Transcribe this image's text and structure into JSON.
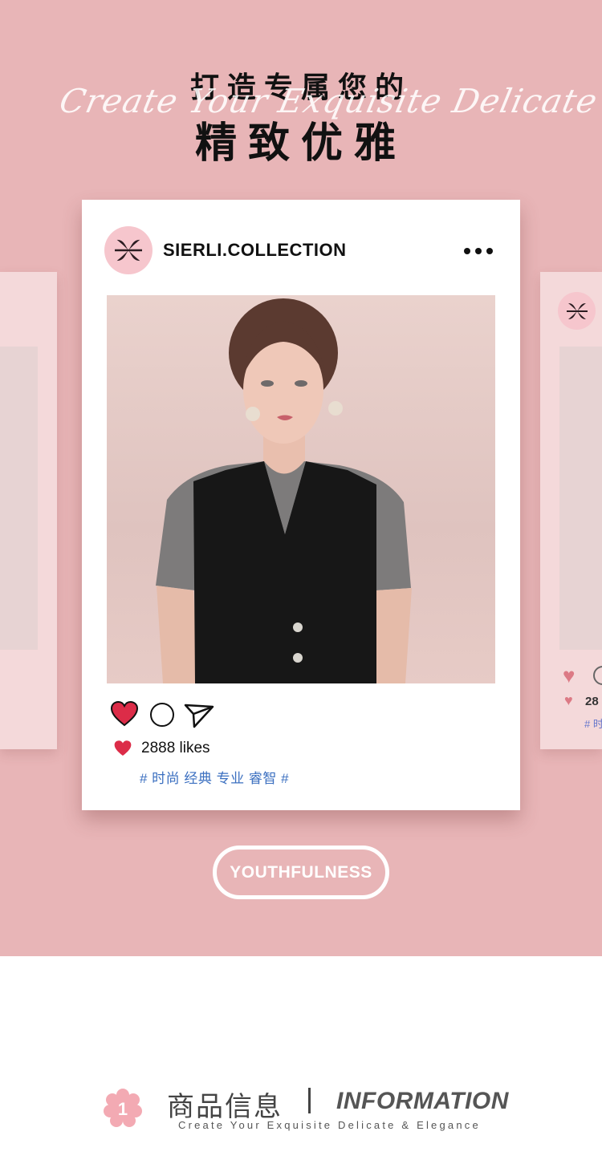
{
  "headline": {
    "line1": "打造专属您的",
    "script": "Create Your Exquisite Delicate & Elegance",
    "line2": "精致优雅"
  },
  "post": {
    "username": "SIERLI.COLLECTION",
    "more_icon": "more-horizontal-icon",
    "actions": {
      "like_icon": "heart-icon",
      "comment_icon": "comment-circle-icon",
      "share_icon": "send-icon"
    },
    "likes": "2888 likes",
    "tags": "# 时尚 经典 专业 睿智 #"
  },
  "side_card": {
    "likes_partial": "28",
    "tags_partial": "# 时"
  },
  "pill_button": "YOUTHFULNESS",
  "section": {
    "badge_number": "1",
    "title_cn": "商品信息",
    "title_en": "INFORMATION",
    "subtitle": "Create Your Exquisite Delicate & Elegance"
  },
  "colors": {
    "hero_background": "#e8b5b7",
    "side_card": "#f4d9da",
    "heart_red": "#dc2c48",
    "tag_blue": "#3b6fc0",
    "badge_pink": "#f3aab3"
  }
}
